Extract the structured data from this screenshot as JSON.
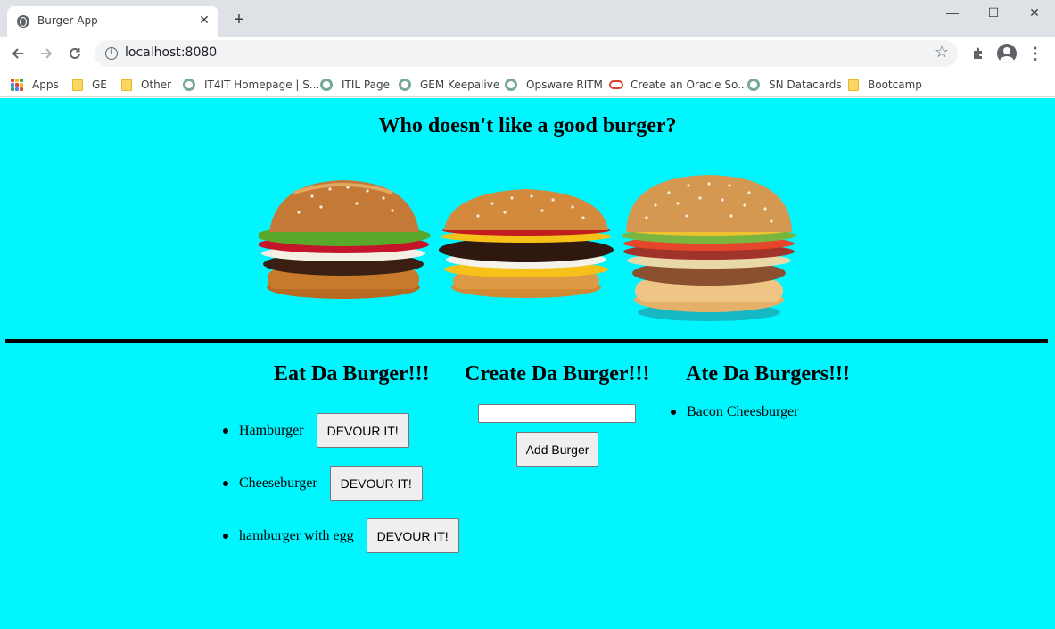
{
  "browser": {
    "tab_title": "Burger App",
    "tab_close": "✕",
    "new_tab": "+",
    "url": "localhost:8080",
    "window_controls": {
      "minimize": "—",
      "maximize": "☐",
      "close": "✕"
    },
    "bookmarks": [
      {
        "label": "Apps",
        "icon": "apps-grid-icon"
      },
      {
        "label": "GE",
        "icon": "folder-icon"
      },
      {
        "label": "Other",
        "icon": "folder-icon"
      },
      {
        "label": "IT4IT Homepage | S...",
        "icon": "globe-icon"
      },
      {
        "label": "ITIL Page",
        "icon": "globe-icon"
      },
      {
        "label": "GEM Keepalive",
        "icon": "globe-icon"
      },
      {
        "label": "Opsware RITM",
        "icon": "globe-icon"
      },
      {
        "label": "Create an Oracle So...",
        "icon": "oracle-icon"
      },
      {
        "label": "SN Datacards",
        "icon": "globe-icon"
      },
      {
        "label": "Bootcamp",
        "icon": "folder-icon"
      }
    ]
  },
  "page": {
    "title": "Who doesn't like a good burger?",
    "background": "#00f5ff",
    "columns": {
      "eat": {
        "heading": "Eat Da Burger!!!"
      },
      "create": {
        "heading": "Create Da Burger!!!",
        "button": "Add Burger",
        "input_value": ""
      },
      "ate": {
        "heading": "Ate Da Burgers!!!"
      }
    },
    "burgers_to_eat": [
      {
        "name": "Hamburger",
        "button": "DEVOUR IT!"
      },
      {
        "name": "Cheeseburger",
        "button": "DEVOUR IT!"
      },
      {
        "name": "hamburger with egg",
        "button": "DEVOUR IT!"
      }
    ],
    "burgers_eaten": [
      {
        "name": "Bacon Cheesburger"
      }
    ]
  }
}
